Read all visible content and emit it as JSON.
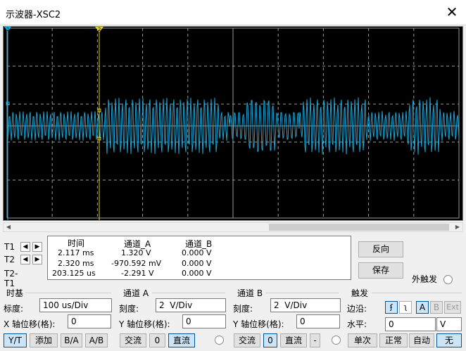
{
  "window": {
    "title": "示波器-XSC2",
    "close_glyph": "✕"
  },
  "colors": {
    "trace_a": "#1aa6d6",
    "grid": "#9a9a9a",
    "cursor_t2": "#e6d030",
    "cursor_t1": "#1aa6d6",
    "background": "#000000"
  },
  "cursor_markers": {
    "t1": "1",
    "t2": "2"
  },
  "cursors": {
    "labels": [
      "T1",
      "T2",
      "T2-T1"
    ],
    "left_glyph": "◀",
    "right_glyph": "▶"
  },
  "readout": {
    "headers": {
      "time": "时间",
      "channel_a": "通道_A",
      "channel_b": "通道_B"
    },
    "rows": [
      {
        "time": "2.117 ms",
        "a": "1.320 V",
        "b": "0.000 V"
      },
      {
        "time": "2.320 ms",
        "a": "-970.592 mV",
        "b": "0.000 V"
      },
      {
        "time": "203.125 us",
        "a": "-2.291 V",
        "b": "0.000 V"
      }
    ]
  },
  "buttons": {
    "reverse": "反向",
    "save": "保存",
    "ext_trigger": "外触发"
  },
  "timebase": {
    "title": "时基",
    "scale_label": "标度:",
    "scale_value": "100 us/Div",
    "xpos_label": "X 轴位移(格):",
    "xpos_value": "0",
    "modes": [
      "Y/T",
      "添加",
      "B/A",
      "A/B"
    ]
  },
  "channel_a": {
    "title": "通道 A",
    "scale_label": "刻度:",
    "scale_value": "2  V/Div",
    "ypos_label": "Y 轴位移(格):",
    "ypos_value": "0",
    "coupling": [
      "交流",
      "0",
      "直流"
    ]
  },
  "channel_b": {
    "title": "通道 B",
    "scale_label": "刻度:",
    "scale_value": "2  V/Div",
    "ypos_label": "Y 轴位移(格):",
    "ypos_value": "0",
    "coupling": [
      "交流",
      "0",
      "直流",
      "-"
    ]
  },
  "trigger": {
    "title": "触发",
    "edge_label": "边沿:",
    "edge_rise": "ʄ",
    "edge_fall": "ʅ",
    "sources": [
      "A",
      "B",
      "Ext"
    ],
    "level_label": "水平:",
    "level_value": "0",
    "level_unit": "V",
    "modes": [
      "单次",
      "正常",
      "自动",
      "无"
    ]
  },
  "scrollbar": {
    "left_glyph": "◀",
    "right_glyph": "▶"
  }
}
